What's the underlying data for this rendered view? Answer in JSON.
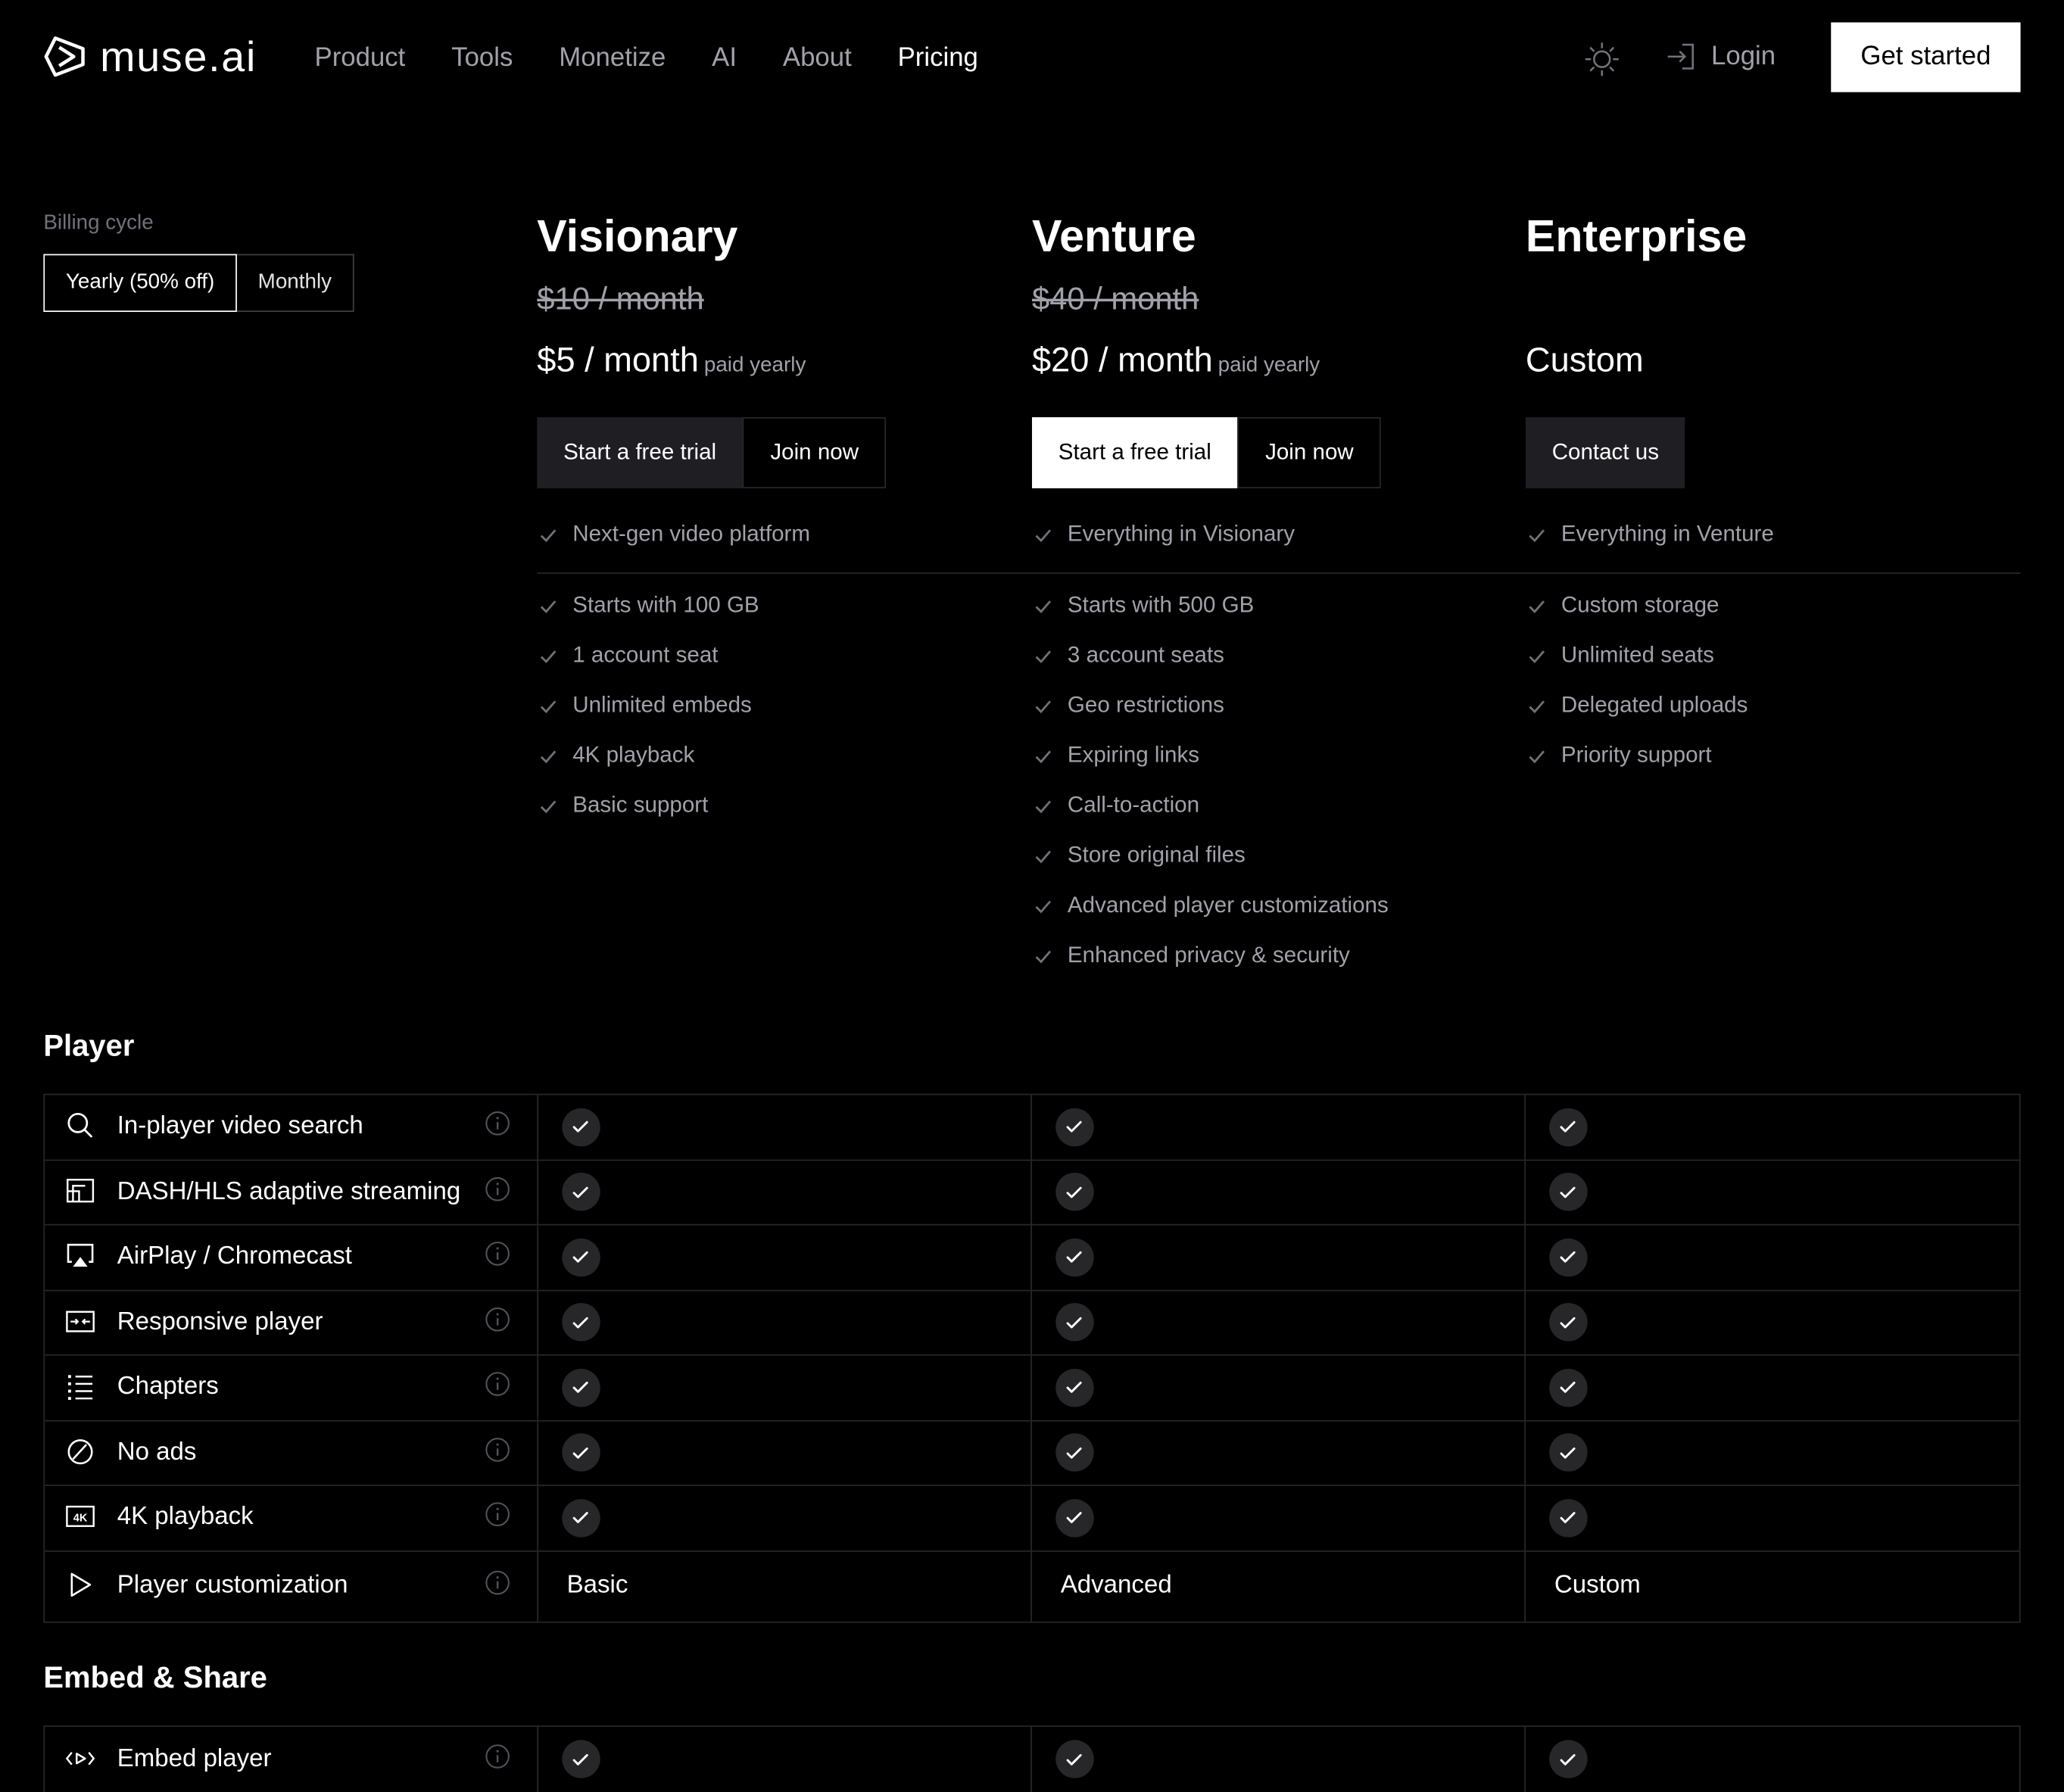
{
  "brand": {
    "name": "muse.ai"
  },
  "nav": {
    "items": [
      "Product",
      "Tools",
      "Monetize",
      "AI",
      "About",
      "Pricing"
    ],
    "active": "Pricing"
  },
  "header": {
    "login": "Login",
    "cta": "Get started"
  },
  "billing": {
    "label": "Billing cycle",
    "options": [
      "Yearly (50% off)",
      "Monthly"
    ],
    "selected": "Yearly (50% off)"
  },
  "plans": [
    {
      "name": "Visionary",
      "old_price": "$10 / month",
      "price": "$5 / month",
      "price_note": "paid yearly",
      "buttons": [
        "Start a free trial",
        "Join now"
      ],
      "headline": "Next-gen video platform",
      "features": [
        "Starts with 100 GB",
        "1 account seat",
        "Unlimited embeds",
        "4K playback",
        "Basic support"
      ]
    },
    {
      "name": "Venture",
      "old_price": "$40 / month",
      "price": "$20 / month",
      "price_note": "paid yearly",
      "buttons": [
        "Start a free trial",
        "Join now"
      ],
      "headline": "Everything in Visionary",
      "features": [
        "Starts with 500 GB",
        "3 account seats",
        "Geo restrictions",
        "Expiring links",
        "Call-to-action",
        "Store original files",
        "Advanced player customizations",
        "Enhanced privacy & security"
      ]
    },
    {
      "name": "Enterprise",
      "old_price": "",
      "price": "Custom",
      "price_note": "",
      "buttons": [
        "Contact us"
      ],
      "headline": "Everything in Venture",
      "features": [
        "Custom storage",
        "Unlimited seats",
        "Delegated uploads",
        "Priority support"
      ]
    }
  ],
  "sections": [
    {
      "title": "Player",
      "rows": [
        {
          "label": "In-player video search",
          "icon": "search-icon",
          "values": [
            "check",
            "check",
            "check"
          ]
        },
        {
          "label": "DASH/HLS adaptive streaming",
          "icon": "adaptive-streaming-icon",
          "values": [
            "check",
            "check",
            "check"
          ]
        },
        {
          "label": "AirPlay / Chromecast",
          "icon": "airplay-icon",
          "values": [
            "check",
            "check",
            "check"
          ]
        },
        {
          "label": "Responsive player",
          "icon": "responsive-icon",
          "values": [
            "check",
            "check",
            "check"
          ]
        },
        {
          "label": "Chapters",
          "icon": "list-icon",
          "values": [
            "check",
            "check",
            "check"
          ]
        },
        {
          "label": "No ads",
          "icon": "no-ads-icon",
          "values": [
            "check",
            "check",
            "check"
          ]
        },
        {
          "label": "4K playback",
          "icon": "4k-icon",
          "values": [
            "check",
            "check",
            "check"
          ]
        },
        {
          "label": "Player customization",
          "icon": "play-icon",
          "values": [
            "Basic",
            "Advanced",
            "Custom"
          ]
        }
      ]
    },
    {
      "title": "Embed & Share",
      "rows": [
        {
          "label": "Embed player",
          "icon": "embed-icon",
          "values": [
            "check",
            "check",
            "check"
          ]
        }
      ]
    }
  ]
}
